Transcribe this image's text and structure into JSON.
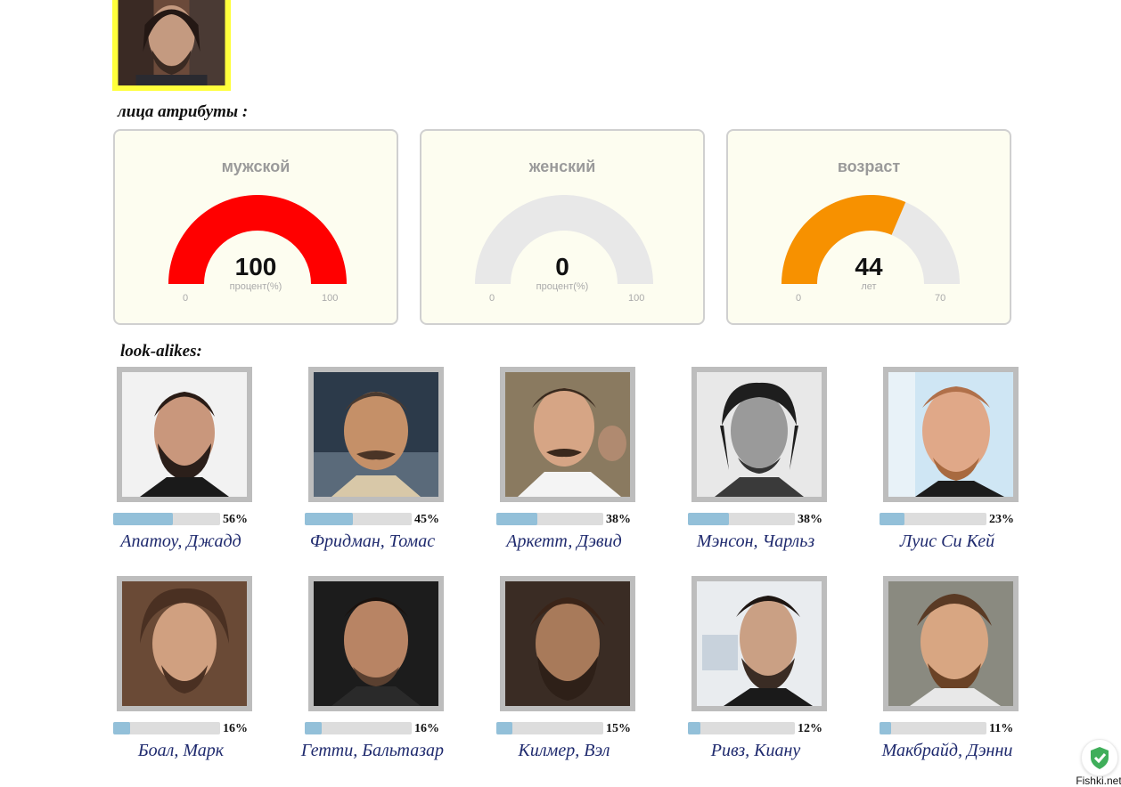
{
  "query_photo": {
    "name": "query-face-photo"
  },
  "attributes_title": "лица атрибуты :",
  "gauges": [
    {
      "title": "мужской",
      "value": 100,
      "value_text": "100",
      "unit": "процент(%)",
      "min": "0",
      "max": "100",
      "range_max": 100,
      "color": "#ff0000"
    },
    {
      "title": "женский",
      "value": 0,
      "value_text": "0",
      "unit": "процент(%)",
      "min": "0",
      "max": "100",
      "range_max": 100,
      "color": "#ff0000"
    },
    {
      "title": "возраст",
      "value": 44,
      "value_text": "44",
      "unit": "лет",
      "min": "0",
      "max": "70",
      "range_max": 70,
      "color": "#f79100"
    }
  ],
  "lookalikes_title": "look-alikes:",
  "lookalikes": [
    {
      "name": "Апатоу, Джадд",
      "percent": 56,
      "percent_text": "56%"
    },
    {
      "name": "Фридман, Томас",
      "percent": 45,
      "percent_text": "45%"
    },
    {
      "name": "Аркетт, Дэвид",
      "percent": 38,
      "percent_text": "38%"
    },
    {
      "name": "Мэнсон, Чарльз",
      "percent": 38,
      "percent_text": "38%"
    },
    {
      "name": "Луис Си Кей",
      "percent": 23,
      "percent_text": "23%"
    },
    {
      "name": "Боал, Марк",
      "percent": 16,
      "percent_text": "16%"
    },
    {
      "name": "Гетти, Бальтазар",
      "percent": 16,
      "percent_text": "16%"
    },
    {
      "name": "Килмер, Вэл",
      "percent": 15,
      "percent_text": "15%"
    },
    {
      "name": "Ривз, Киану",
      "percent": 12,
      "percent_text": "12%"
    },
    {
      "name": "Макбрайд, Дэнни",
      "percent": 11,
      "percent_text": "11%"
    }
  ],
  "colors": {
    "bar_fill": "#93c0d9",
    "bar_track": "#dddddd",
    "gauge_track": "#e8e8e8",
    "name_color": "#1f2a6e",
    "query_border": "#ffff3c"
  },
  "watermark": {
    "text": "Fishki.net",
    "icon": "shield-check-icon"
  }
}
